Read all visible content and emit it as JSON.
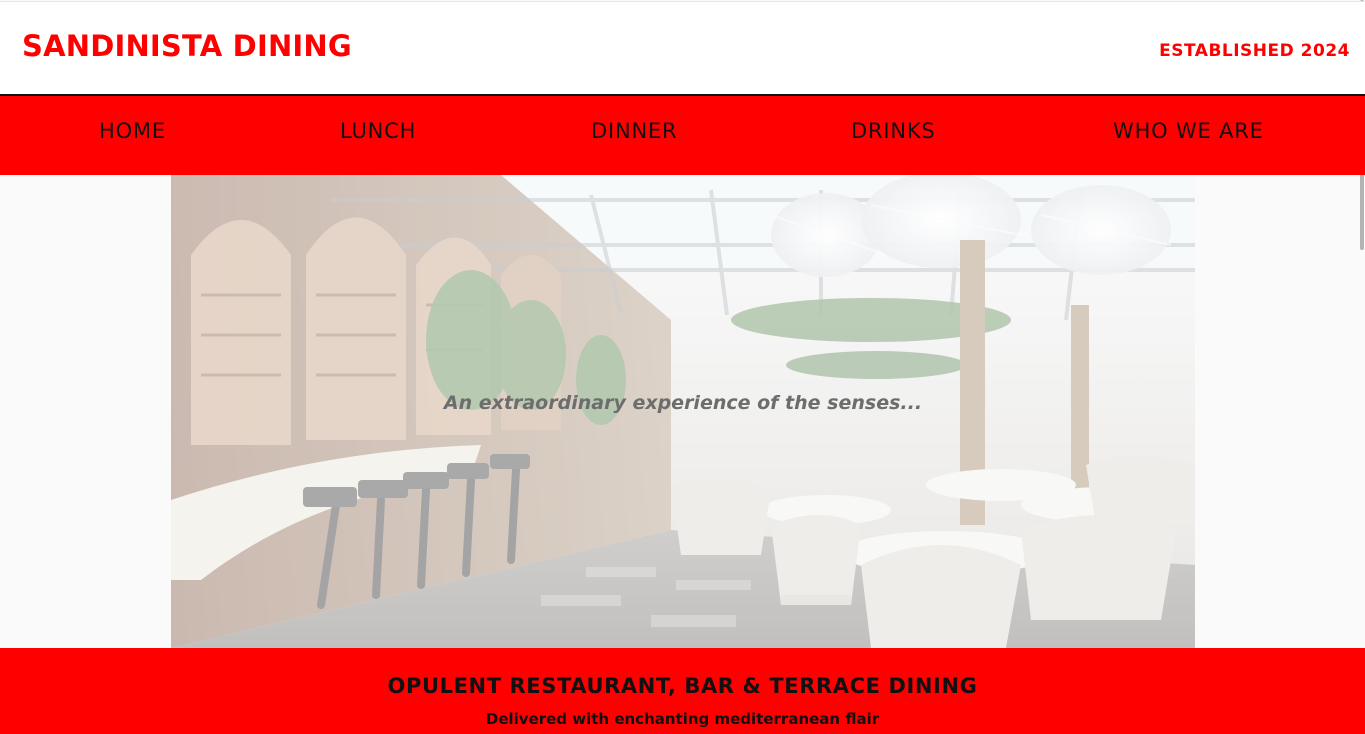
{
  "header": {
    "brand": "SANDINISTA DINING",
    "established": "ESTABLISHED 2024"
  },
  "nav": {
    "items": [
      {
        "label": "HOME"
      },
      {
        "label": "LUNCH"
      },
      {
        "label": "DINNER"
      },
      {
        "label": "DRINKS"
      },
      {
        "label": "WHO WE ARE"
      }
    ]
  },
  "hero": {
    "tagline": "An extraordinary experience of the senses..."
  },
  "banner": {
    "title": "OPULENT RESTAURANT, BAR & TERRACE DINING",
    "subtitle": "Delivered with enchanting mediterranean flair"
  },
  "colors": {
    "accent": "#ff0000",
    "text_dark": "#111111",
    "background": "#fafafa",
    "header_background": "#ffffff"
  }
}
